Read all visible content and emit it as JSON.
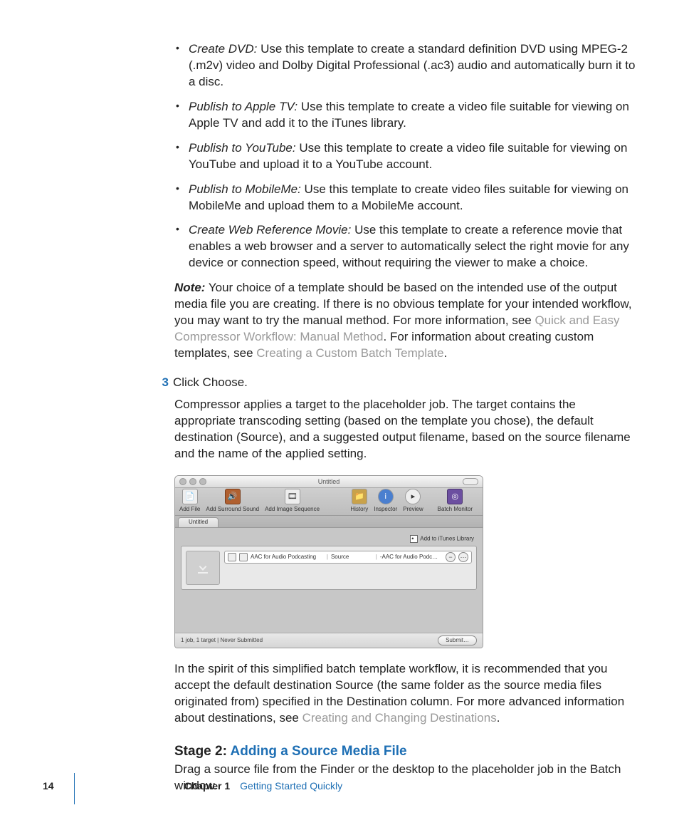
{
  "bullets": [
    {
      "term": "Create DVD:",
      "text": "  Use this template to create a standard definition DVD using MPEG-2 (.m2v) video and Dolby Digital Professional (.ac3) audio and automatically burn it to a disc."
    },
    {
      "term": "Publish to Apple TV:",
      "text": "  Use this template to create a video file suitable for viewing on Apple TV and add it to the iTunes library."
    },
    {
      "term": "Publish to YouTube:",
      "text": "  Use this template to create a video file suitable for viewing on YouTube and upload it to a YouTube account."
    },
    {
      "term": "Publish to MobileMe:",
      "text": "  Use this template to create video files suitable for viewing on MobileMe and upload them to a MobileMe account."
    },
    {
      "term": "Create Web Reference Movie:",
      "text": "  Use this template to create a reference movie that enables a web browser and a server to automatically select the right movie for any device or connection speed, without requiring the viewer to make a choice."
    }
  ],
  "note": {
    "label": "Note:",
    "part1": "  Your choice of a template should be based on the intended use of the output media file you are creating. If there is no obvious template for your intended workflow, you may want to try the manual method. For more information, see ",
    "link1": "Quick and Easy Compressor Workflow: Manual Method",
    "part2": ". For information about creating custom templates, see ",
    "link2": "Creating a Custom Batch Template",
    "part3": "."
  },
  "step": {
    "num": "3",
    "text": "Click Choose.",
    "desc": "Compressor applies a target to the placeholder job. The target contains the appropriate transcoding setting (based on the template you chose), the default destination (Source), and a suggested output filename, based on the source filename and the name of the applied setting."
  },
  "win": {
    "title": "Untitled",
    "toolbar": {
      "addFile": "Add File",
      "addSurround": "Add Surround Sound",
      "addImageSeq": "Add Image Sequence",
      "history": "History",
      "inspector": "Inspector",
      "preview": "Preview",
      "batchMonitor": "Batch Monitor"
    },
    "tab": "Untitled",
    "jobHeader": "Add to iTunes Library",
    "target": {
      "setting": "AAC for Audio Podcasting",
      "dest": "Source",
      "outfile": "-AAC for Audio Podc…"
    },
    "status": "1 job, 1 target   |   Never Submitted",
    "submit": "Submit…"
  },
  "afterwin": {
    "part1": "In the spirit of this simplified batch template workflow, it is recommended that you accept the default destination Source (the same folder as the source media files originated from) specified in the Destination column. For more advanced information about destinations, see ",
    "link": "Creating and Changing Destinations",
    "part2": "."
  },
  "stage2": {
    "label": "Stage 2: ",
    "title": "Adding a Source Media File",
    "text": "Drag a source file from the Finder or the desktop to the placeholder job in the Batch window."
  },
  "footer": {
    "page": "14",
    "chapter": "Chapter 1",
    "title": "Getting Started Quickly"
  }
}
